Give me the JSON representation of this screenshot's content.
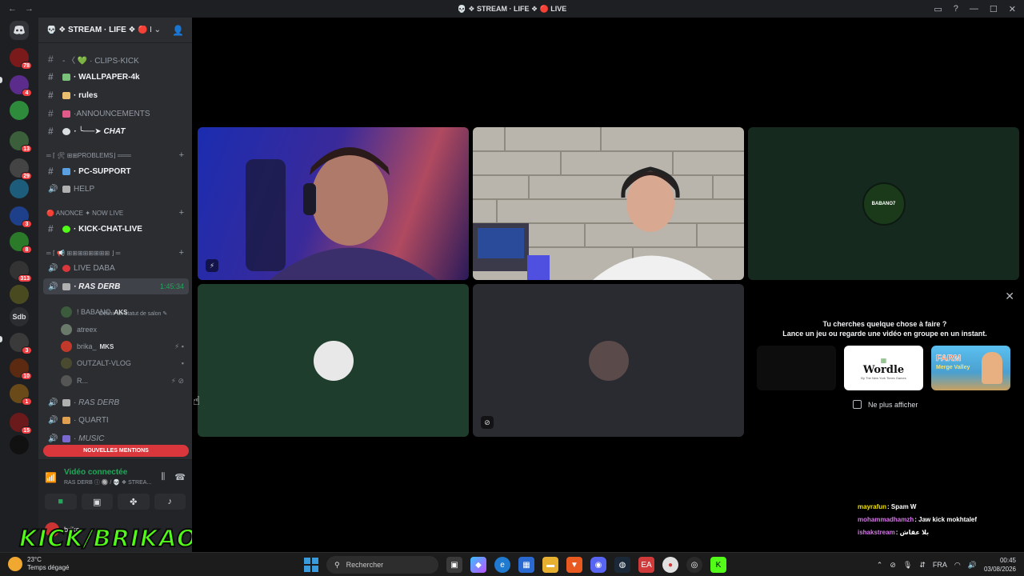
{
  "titlebar": {
    "back_glyph": "←",
    "forward_glyph": "→",
    "title": "💀 ❖ STREAM · LIFE ❖ 🔴 LIVE",
    "controls": [
      "▭",
      "?",
      "—",
      "☐",
      "✕"
    ]
  },
  "server_rail": {
    "badges": [
      "78",
      "4",
      "13",
      "29",
      "3",
      "8",
      "313",
      "3",
      "10",
      "1",
      "15"
    ],
    "sdb_label": "Sdb"
  },
  "guild": {
    "name": "💀 ❖ STREAM · LIFE ❖ 🔴 L...",
    "chevron": "⌄",
    "invite_glyph": "👤"
  },
  "channels": [
    {
      "label": "- 〈 💚 · CLIPS-KICK",
      "kind": "text"
    },
    {
      "label": "· WALLPAPER-4k",
      "kind": "text",
      "bright": true
    },
    {
      "label": "· rules",
      "kind": "text",
      "bright": true
    },
    {
      "label": "·ANNOUNCEMENTS",
      "kind": "text"
    },
    {
      "label": "· ╰──➤ CHAT",
      "kind": "text",
      "bright": true
    },
    {
      "label": "· PC-SUPPORT",
      "kind": "text",
      "bright": true
    },
    {
      "label": "HELP",
      "kind": "voice"
    },
    {
      "label": "· KICK-CHAT-LIVE",
      "kind": "text",
      "bright": true
    },
    {
      "label": "LIVE DABA",
      "kind": "voice"
    },
    {
      "label": "· RAS DERB",
      "kind": "voice",
      "selected": true,
      "time": "1:45:34"
    },
    {
      "label": "· RAS DERB",
      "kind": "voice"
    },
    {
      "label": "· QUARTI",
      "kind": "voice"
    },
    {
      "label": "· MUSIC",
      "kind": "voice"
    }
  ],
  "categories": [
    {
      "label": "═ ⌈ 🛠 ⊞⊞PROBLEMS⌋ ═══"
    },
    {
      "label": "🔴 ANONCE ✦ NOW LIVE"
    },
    {
      "label": "═ ⌈ 📢 ⊞⊞⊞⊞⊞⊞⊞⊞ ⌋ ═"
    }
  ],
  "status_line": "Définir un statut de salon ✎",
  "voice_users": [
    {
      "name": "! BABANO",
      "tag": "AKS",
      "icons": ""
    },
    {
      "name": "atreex",
      "tag": "",
      "icons": ""
    },
    {
      "name": "brika_",
      "tag": "MKS",
      "icons": "⚡ ▪"
    },
    {
      "name": "OUTZALT-VLOG",
      "tag": "",
      "icons": "▪"
    },
    {
      "name": "R...",
      "tag": "",
      "icons": "⚡ ⊘"
    }
  ],
  "mentions_pill": "NOUVELLES MENTIONS",
  "voice_panel": {
    "status": "Vidéo connectée",
    "location": "RAS DERB ⓘ 🔘 / 💀 ❖ STREA...",
    "username": "brika"
  },
  "kick_overlay": "KICK/BRIKAO",
  "activity": {
    "question": "Tu cherches quelque chose à faire ?",
    "subtitle": "Lance un jeu ou regarde une vidéo en groupe en un instant.",
    "cards": [
      {
        "name": "",
        "color": "#0d0d0d"
      },
      {
        "name": "Wordle",
        "color": "#ffffff"
      },
      {
        "name": "FARM",
        "color": "#3aa6d8"
      }
    ],
    "wordle_sub": "By The New York Times Games",
    "farm_sub": "Merge Valley",
    "dont_show": "Ne plus afficher"
  },
  "tiles": [
    {
      "kind": "video",
      "color": "#1a2a8c"
    },
    {
      "kind": "video",
      "color": "#b9b5ad"
    },
    {
      "kind": "avatar",
      "color": "#16291f",
      "avatar_text": "BABANO7"
    },
    {
      "kind": "avatar",
      "color": "#1f3d2c"
    },
    {
      "kind": "avatar",
      "color": "#2a2b30"
    }
  ],
  "chat": [
    {
      "user": "mayrafun",
      "text": ": Spam W",
      "color": "#f0e000"
    },
    {
      "user": "mohammadhamzh",
      "text": ": Jaw kick mokhtalef",
      "color": "#d678e8"
    },
    {
      "user": "ishakstream",
      "text": ": بلا عقاش",
      "color": "#d678e8"
    }
  ],
  "taskbar": {
    "temp": "23°C",
    "weather": "Temps dégagé",
    "search_placeholder": "Rechercher",
    "lang": "FRA",
    "time": "00:45",
    "date": "03/08/2026"
  },
  "colors": {
    "accent_green": "#23a55a",
    "mention_red": "#da373c",
    "kick_green": "#53fc18"
  }
}
